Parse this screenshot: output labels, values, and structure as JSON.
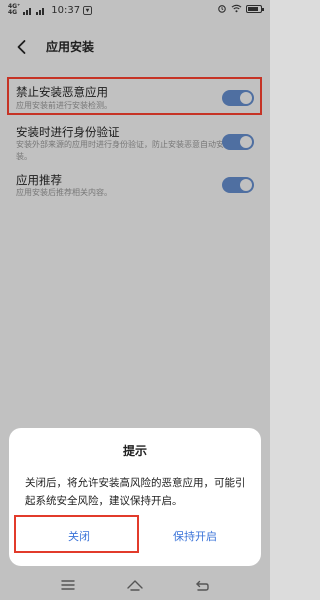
{
  "status_bar": {
    "network_top": "4G⁺",
    "network_bottom": "4G",
    "time": "10:37",
    "battery_level": 0.8
  },
  "header": {
    "title": "应用安装"
  },
  "settings": [
    {
      "title": "禁止安装恶意应用",
      "desc": "应用安装前进行安装检测。",
      "on": true
    },
    {
      "title": "安装时进行身份验证",
      "desc": "安装外部来源的应用时进行身份验证，防止安装恶意自动安装。",
      "on": true
    },
    {
      "title": "应用推荐",
      "desc": "应用安装后推荐相关内容。",
      "on": true
    }
  ],
  "dialog": {
    "title": "提示",
    "message": "关闭后，将允许安装高风险的恶意应用，可能引起系统安全风险，建议保持开启。",
    "cancel_label": "关闭",
    "confirm_label": "保持开启"
  },
  "colors": {
    "accent": "#3b74d9",
    "highlight": "#e23b2b",
    "toggle_on": "#5b7fb8"
  },
  "icons": {
    "back": "chevron-left-icon",
    "nav_menu": "menu-icon",
    "nav_home": "home-icon",
    "nav_back": "return-icon"
  }
}
